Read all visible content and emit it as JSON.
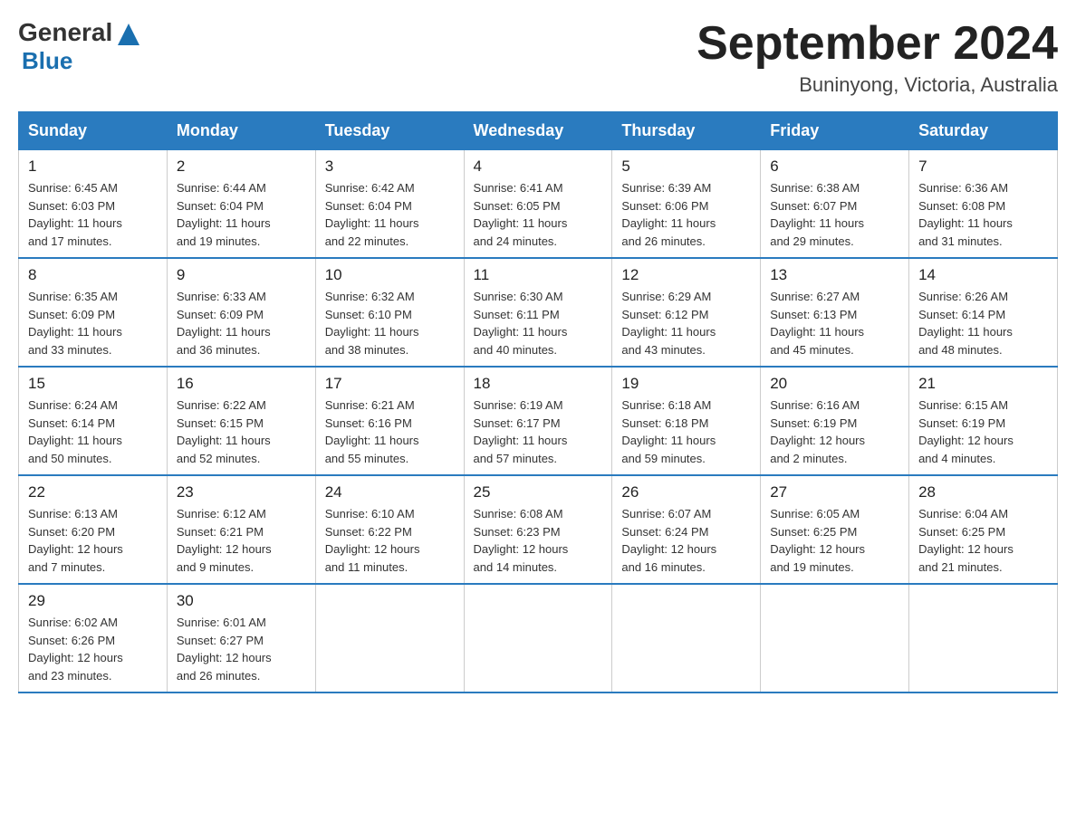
{
  "header": {
    "logo_general": "General",
    "logo_blue": "Blue",
    "title": "September 2024",
    "location": "Buninyong, Victoria, Australia"
  },
  "days_of_week": [
    "Sunday",
    "Monday",
    "Tuesday",
    "Wednesday",
    "Thursday",
    "Friday",
    "Saturday"
  ],
  "weeks": [
    [
      {
        "day": "1",
        "sunrise": "6:45 AM",
        "sunset": "6:03 PM",
        "daylight": "11 hours and 17 minutes."
      },
      {
        "day": "2",
        "sunrise": "6:44 AM",
        "sunset": "6:04 PM",
        "daylight": "11 hours and 19 minutes."
      },
      {
        "day": "3",
        "sunrise": "6:42 AM",
        "sunset": "6:04 PM",
        "daylight": "11 hours and 22 minutes."
      },
      {
        "day": "4",
        "sunrise": "6:41 AM",
        "sunset": "6:05 PM",
        "daylight": "11 hours and 24 minutes."
      },
      {
        "day": "5",
        "sunrise": "6:39 AM",
        "sunset": "6:06 PM",
        "daylight": "11 hours and 26 minutes."
      },
      {
        "day": "6",
        "sunrise": "6:38 AM",
        "sunset": "6:07 PM",
        "daylight": "11 hours and 29 minutes."
      },
      {
        "day": "7",
        "sunrise": "6:36 AM",
        "sunset": "6:08 PM",
        "daylight": "11 hours and 31 minutes."
      }
    ],
    [
      {
        "day": "8",
        "sunrise": "6:35 AM",
        "sunset": "6:09 PM",
        "daylight": "11 hours and 33 minutes."
      },
      {
        "day": "9",
        "sunrise": "6:33 AM",
        "sunset": "6:09 PM",
        "daylight": "11 hours and 36 minutes."
      },
      {
        "day": "10",
        "sunrise": "6:32 AM",
        "sunset": "6:10 PM",
        "daylight": "11 hours and 38 minutes."
      },
      {
        "day": "11",
        "sunrise": "6:30 AM",
        "sunset": "6:11 PM",
        "daylight": "11 hours and 40 minutes."
      },
      {
        "day": "12",
        "sunrise": "6:29 AM",
        "sunset": "6:12 PM",
        "daylight": "11 hours and 43 minutes."
      },
      {
        "day": "13",
        "sunrise": "6:27 AM",
        "sunset": "6:13 PM",
        "daylight": "11 hours and 45 minutes."
      },
      {
        "day": "14",
        "sunrise": "6:26 AM",
        "sunset": "6:14 PM",
        "daylight": "11 hours and 48 minutes."
      }
    ],
    [
      {
        "day": "15",
        "sunrise": "6:24 AM",
        "sunset": "6:14 PM",
        "daylight": "11 hours and 50 minutes."
      },
      {
        "day": "16",
        "sunrise": "6:22 AM",
        "sunset": "6:15 PM",
        "daylight": "11 hours and 52 minutes."
      },
      {
        "day": "17",
        "sunrise": "6:21 AM",
        "sunset": "6:16 PM",
        "daylight": "11 hours and 55 minutes."
      },
      {
        "day": "18",
        "sunrise": "6:19 AM",
        "sunset": "6:17 PM",
        "daylight": "11 hours and 57 minutes."
      },
      {
        "day": "19",
        "sunrise": "6:18 AM",
        "sunset": "6:18 PM",
        "daylight": "11 hours and 59 minutes."
      },
      {
        "day": "20",
        "sunrise": "6:16 AM",
        "sunset": "6:19 PM",
        "daylight": "12 hours and 2 minutes."
      },
      {
        "day": "21",
        "sunrise": "6:15 AM",
        "sunset": "6:19 PM",
        "daylight": "12 hours and 4 minutes."
      }
    ],
    [
      {
        "day": "22",
        "sunrise": "6:13 AM",
        "sunset": "6:20 PM",
        "daylight": "12 hours and 7 minutes."
      },
      {
        "day": "23",
        "sunrise": "6:12 AM",
        "sunset": "6:21 PM",
        "daylight": "12 hours and 9 minutes."
      },
      {
        "day": "24",
        "sunrise": "6:10 AM",
        "sunset": "6:22 PM",
        "daylight": "12 hours and 11 minutes."
      },
      {
        "day": "25",
        "sunrise": "6:08 AM",
        "sunset": "6:23 PM",
        "daylight": "12 hours and 14 minutes."
      },
      {
        "day": "26",
        "sunrise": "6:07 AM",
        "sunset": "6:24 PM",
        "daylight": "12 hours and 16 minutes."
      },
      {
        "day": "27",
        "sunrise": "6:05 AM",
        "sunset": "6:25 PM",
        "daylight": "12 hours and 19 minutes."
      },
      {
        "day": "28",
        "sunrise": "6:04 AM",
        "sunset": "6:25 PM",
        "daylight": "12 hours and 21 minutes."
      }
    ],
    [
      {
        "day": "29",
        "sunrise": "6:02 AM",
        "sunset": "6:26 PM",
        "daylight": "12 hours and 23 minutes."
      },
      {
        "day": "30",
        "sunrise": "6:01 AM",
        "sunset": "6:27 PM",
        "daylight": "12 hours and 26 minutes."
      },
      null,
      null,
      null,
      null,
      null
    ]
  ],
  "labels": {
    "sunrise": "Sunrise:",
    "sunset": "Sunset:",
    "daylight": "Daylight:"
  }
}
